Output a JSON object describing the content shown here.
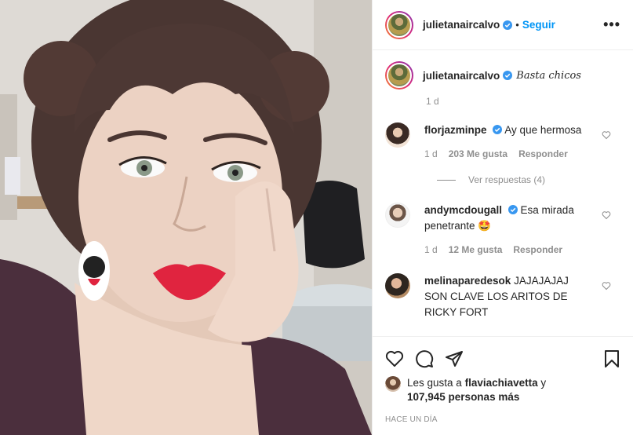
{
  "header": {
    "username": "julietanaircalvo",
    "separator": "•",
    "follow_label": "Seguir",
    "more_label": "•••"
  },
  "caption": {
    "username": "julietanaircalvo",
    "text": "Basta chicos",
    "age": "1 d"
  },
  "comments": [
    {
      "username": "florjazminpe",
      "verified": true,
      "text": "Ay que hermosa",
      "age": "1 d",
      "likes": "203 Me gusta",
      "reply_label": "Responder",
      "view_replies": "Ver respuestas (4)"
    },
    {
      "username": "andymcdougall",
      "verified": true,
      "text": "Esa mirada penetrante 🤩",
      "age": "1 d",
      "likes": "12 Me gusta",
      "reply_label": "Responder"
    },
    {
      "username": "melinaparedesok",
      "verified": false,
      "text": "JAJAJAJAJ SON CLAVE LOS ARITOS DE RICKY FORT"
    }
  ],
  "actions": {
    "like_icon": "heart-icon",
    "comment_icon": "comment-icon",
    "share_icon": "paper-plane-icon",
    "save_icon": "bookmark-icon"
  },
  "likes": {
    "prefix": "Les gusta a",
    "user": "flaviachiavetta",
    "connector": "y",
    "count": "107,945 personas más"
  },
  "timestamp": "HACE UN DÍA",
  "colors": {
    "accent": "#0095f6",
    "verified": "#3897f0",
    "muted": "#8e8e8e",
    "lips": "#e0243f"
  }
}
